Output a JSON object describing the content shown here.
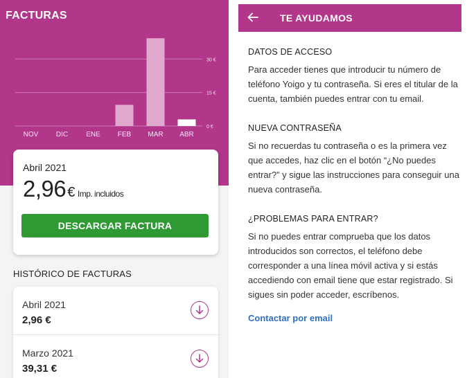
{
  "left": {
    "title": "FACTURAS",
    "chart_data": {
      "type": "bar",
      "categories": [
        "NOV",
        "DIC",
        "ENE",
        "FEB",
        "MAR",
        "ABR"
      ],
      "values": [
        0,
        0,
        0,
        9.5,
        39.31,
        2.96
      ],
      "highlight_index": 5,
      "y_ticks": [
        "30 €",
        "15 €",
        "0 €"
      ],
      "ylim": [
        0,
        40
      ],
      "bar_color": "#e0a8cc",
      "highlight_color": "#ffffff"
    },
    "summary": {
      "month": "Abril 2021",
      "amount": "2,96",
      "currency": "€",
      "tax_note": "Imp. incluidos",
      "download_label": "DESCARGAR FACTURA"
    },
    "history": {
      "title": "HISTÓRICO DE FACTURAS",
      "items": [
        {
          "month": "Abril 2021",
          "amount": "2,96 €"
        },
        {
          "month": "Marzo 2021",
          "amount": "39,31 €"
        }
      ]
    }
  },
  "right": {
    "title": "TE AYUDAMOS",
    "sections": [
      {
        "heading": "DATOS DE ACCESO",
        "text": "Para acceder tienes que introducir tu número de teléfono Yoigo y tu contraseña. Si eres el titular de la cuenta, también puedes entrar con tu email."
      },
      {
        "heading": "NUEVA CONTRASEÑA",
        "text": "Si no recuerdas tu contraseña o es la primera vez que accedes, haz clic en el botón “¿No puedes entrar?” y sigue las instrucciones para conseguir una nueva contraseña."
      },
      {
        "heading": "¿PROBLEMAS PARA ENTRAR?",
        "text": "Si no puedes entrar comprueba que los datos introducidos son correctos, el teléfono debe corresponder a una línea móvil activa y si estás accediendo con email tiene que estar registrado. Si sigues sin poder acceder,  escríbenos."
      }
    ],
    "contact_link": "Contactar por email"
  },
  "colors": {
    "brand": "#b2368a",
    "button": "#2f9a34",
    "link": "#2f6fc6"
  }
}
